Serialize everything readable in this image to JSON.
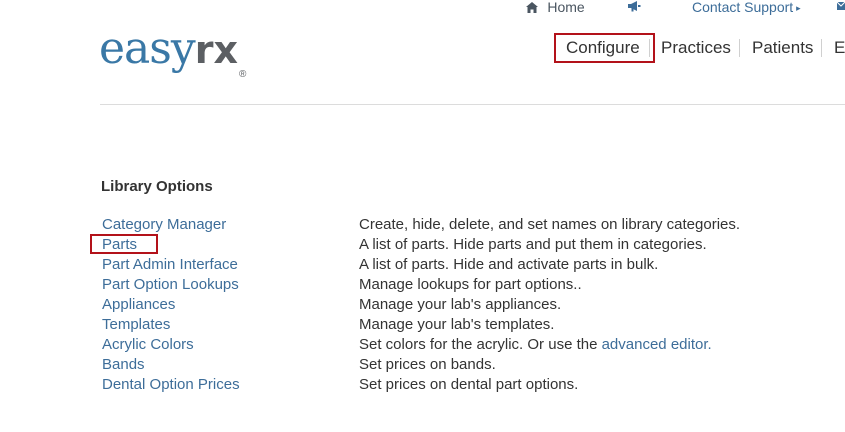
{
  "topbar": {
    "home_icon": "home-icon",
    "home_label": "Home",
    "announce_icon": "megaphone-icon",
    "support_label": "Contact Support",
    "support_caret": "▸",
    "extra_icon": "envelope-icon"
  },
  "logo": {
    "easy": "easy",
    "rx": "rx",
    "reg": "®"
  },
  "nav": {
    "items": [
      {
        "label": "Configure"
      },
      {
        "label": "Practices"
      },
      {
        "label": "Patients"
      },
      {
        "label": "E"
      }
    ]
  },
  "library": {
    "title": "Library Options",
    "options": [
      {
        "label": "Category Manager",
        "description": "Create, hide, delete, and set names on library categories."
      },
      {
        "label": "Parts",
        "description": "A list of parts. Hide parts and put them in categories."
      },
      {
        "label": "Part Admin Interface",
        "description": "A list of parts. Hide and activate parts in bulk."
      },
      {
        "label": "Part Option Lookups",
        "description": "Manage lookups for part options.."
      },
      {
        "label": "Appliances",
        "description": "Manage your lab's appliances."
      },
      {
        "label": "Templates",
        "description": "Manage your lab's templates."
      },
      {
        "label": "Acrylic Colors",
        "description": "Set colors for the acrylic. Or use the ",
        "link": "advanced editor."
      },
      {
        "label": "Bands",
        "description": "Set prices on bands."
      },
      {
        "label": "Dental Option Prices",
        "description": "Set prices on dental part options."
      }
    ]
  },
  "colors": {
    "link": "#3d6d99",
    "highlight": "#b3121a",
    "logo_blue": "#3a78a6",
    "logo_gray": "#5c5f63"
  }
}
